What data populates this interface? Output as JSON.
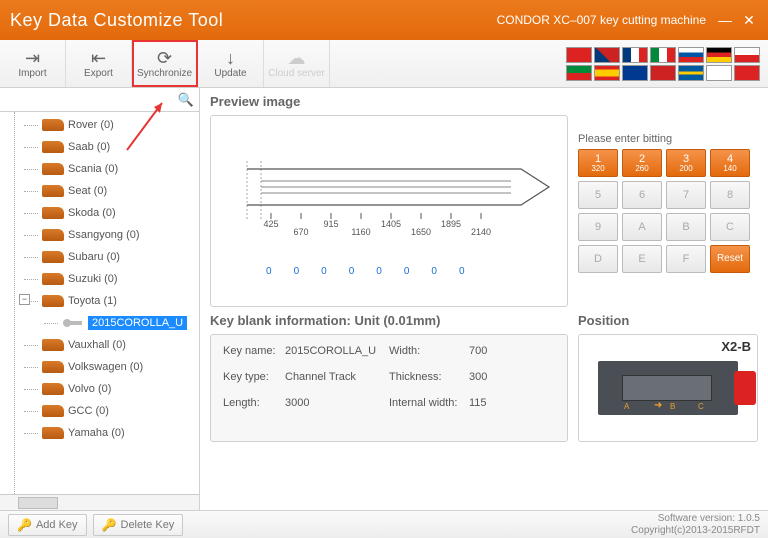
{
  "title": "Key Data Customize Tool",
  "machine": "CONDOR XC–007 key cutting machine",
  "toolbar": {
    "import": "Import",
    "export": "Export",
    "synchronize": "Synchronize",
    "update": "Update",
    "cloud": "Cloud server"
  },
  "tree": [
    {
      "label": "Rover (0)",
      "icon": "car"
    },
    {
      "label": "Saab (0)",
      "icon": "car"
    },
    {
      "label": "Scania (0)",
      "icon": "car"
    },
    {
      "label": "Seat (0)",
      "icon": "car"
    },
    {
      "label": "Skoda (0)",
      "icon": "car"
    },
    {
      "label": "Ssangyong (0)",
      "icon": "car"
    },
    {
      "label": "Subaru (0)",
      "icon": "car"
    },
    {
      "label": "Suzuki (0)",
      "icon": "car"
    },
    {
      "label": "Toyota (1)",
      "icon": "car",
      "expanded": true
    },
    {
      "label": "2015COROLLA_U",
      "icon": "key",
      "child": true,
      "selected": true
    },
    {
      "label": "Vauxhall (0)",
      "icon": "car"
    },
    {
      "label": "Volkswagen (0)",
      "icon": "car"
    },
    {
      "label": "Volvo (0)",
      "icon": "car"
    },
    {
      "label": "GCC (0)",
      "icon": "car"
    },
    {
      "label": "Yamaha (0)",
      "icon": "car"
    }
  ],
  "preview_header": "Preview image",
  "ticks": [
    "425",
    "670",
    "915",
    "1160",
    "1405",
    "1650",
    "1895",
    "2140"
  ],
  "zeros": [
    "0",
    "0",
    "0",
    "0",
    "0",
    "0",
    "0",
    "0"
  ],
  "keypad": {
    "title": "Please enter bitting",
    "top": [
      {
        "n": "1",
        "sub": "320"
      },
      {
        "n": "2",
        "sub": "260"
      },
      {
        "n": "3",
        "sub": "200"
      },
      {
        "n": "4",
        "sub": "140"
      }
    ],
    "rows": [
      [
        "5",
        "6",
        "7",
        "8"
      ],
      [
        "9",
        "A",
        "B",
        "C"
      ],
      [
        "D",
        "E",
        "F",
        "Reset"
      ]
    ]
  },
  "info": {
    "title": "Key blank information: Unit (0.01mm)",
    "key_name_lab": "Key name:",
    "key_name": "2015COROLLA_U",
    "width_lab": "Width:",
    "width": "700",
    "key_type_lab": "Key type:",
    "key_type": "Channel Track",
    "thickness_lab": "Thickness:",
    "thickness": "300",
    "length_lab": "Length:",
    "length": "3000",
    "iwidth_lab": "Internal width:",
    "iwidth": "115"
  },
  "position": {
    "title": "Position",
    "label": "X2-B"
  },
  "footer": {
    "add": "Add Key",
    "delete": "Delete Key",
    "version": "Software version: 1.0.5",
    "copyright": "Copyright(c)2013-2015RFDT"
  }
}
